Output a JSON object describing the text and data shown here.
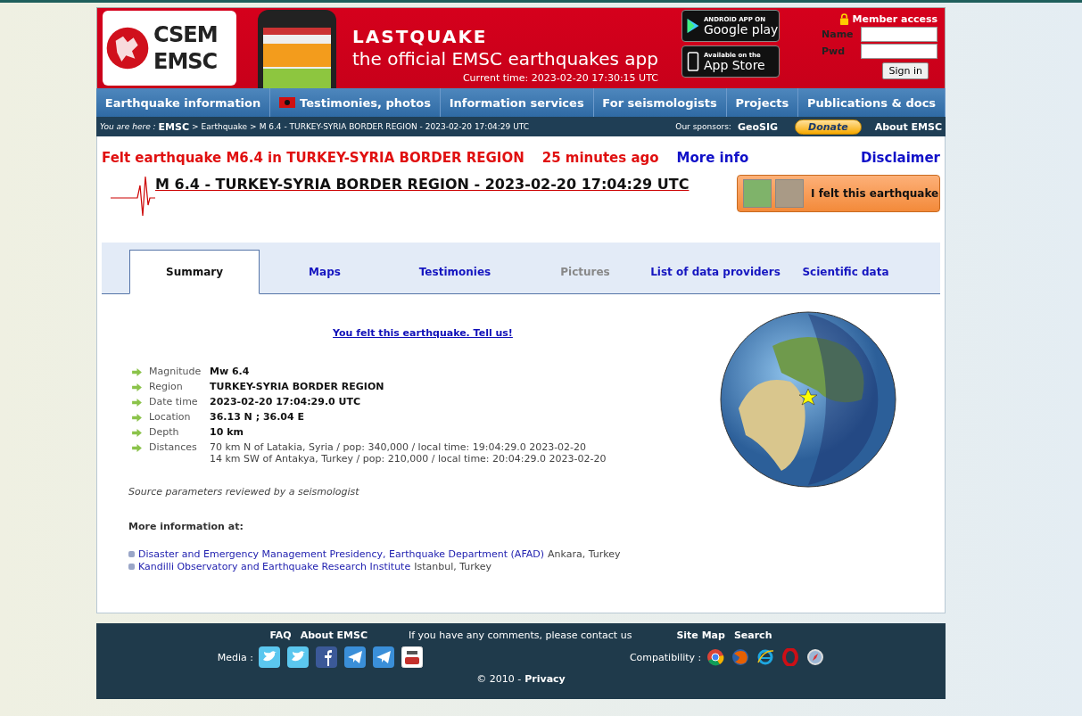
{
  "banner": {
    "logo_lines": [
      "CSEM",
      "EMSC"
    ],
    "app_title": "LASTQUAKE",
    "app_subtitle": "the official EMSC earthquakes app",
    "current_time": "Current time: 2023-02-20 17:30:15 UTC",
    "store_badges": [
      {
        "kind": "android",
        "small": "ANDROID APP ON",
        "big": "Google play"
      },
      {
        "kind": "apple",
        "small": "Available on the",
        "big": "App Store"
      }
    ],
    "member": {
      "title": "Member access",
      "fields": [
        {
          "label": "Name"
        },
        {
          "label": "Pwd"
        }
      ],
      "button": "Sign in"
    }
  },
  "nav": [
    {
      "label": "Earthquake information",
      "kind": "plain"
    },
    {
      "label": "Testimonies, photos",
      "kind": "flag"
    },
    {
      "label": "Information services",
      "kind": "plain"
    },
    {
      "label": "For seismologists",
      "kind": "plain"
    },
    {
      "label": "Projects",
      "kind": "plain"
    },
    {
      "label": "Publications & docs",
      "kind": "plain"
    }
  ],
  "breadcrumb": {
    "prefix": "You are here :",
    "separator": ">",
    "items": [
      "EMSC",
      "Earthquake",
      "M 6.4 - TURKEY-SYRIA BORDER REGION - 2023-02-20 17:04:29 UTC"
    ],
    "sponsors_label": "Our sponsors:",
    "sponsor": "GeoSIG",
    "donate": "Donate",
    "about": "About EMSC"
  },
  "alert": {
    "text": "Felt earthquake M6.4 in TURKEY-SYRIA BORDER REGION",
    "age": "25 minutes ago",
    "more_info": "More info",
    "disclaimer": "Disclaimer"
  },
  "event_title": "M 6.4 - TURKEY-SYRIA BORDER REGION - 2023-02-20 17:04:29 UTC",
  "felt_button": "I felt this earthquake",
  "tabs": [
    {
      "label": "Summary",
      "selected": true,
      "disabled": false
    },
    {
      "label": "Maps",
      "selected": false,
      "disabled": false
    },
    {
      "label": "Testimonies",
      "selected": false,
      "disabled": false
    },
    {
      "label": "Pictures",
      "selected": false,
      "disabled": true
    },
    {
      "label": "List of data providers",
      "selected": false,
      "disabled": false
    },
    {
      "label": "Scientific data",
      "selected": false,
      "disabled": false
    }
  ],
  "felt_link": "You felt this earthquake. Tell us!",
  "params": [
    {
      "label": "Magnitude",
      "values": [
        "Mw 6.4"
      ],
      "bold": true
    },
    {
      "label": "Region",
      "values": [
        "TURKEY-SYRIA BORDER REGION"
      ],
      "bold": true
    },
    {
      "label": "Date time",
      "values": [
        "2023-02-20 17:04:29.0 UTC"
      ],
      "bold": true
    },
    {
      "label": "Location",
      "values": [
        "36.13 N ; 36.04 E"
      ],
      "bold": true
    },
    {
      "label": "Depth",
      "values": [
        "10 km"
      ],
      "bold": true
    },
    {
      "label": "Distances",
      "values": [
        "70 km N of Latakia, Syria / pop: 340,000 / local time: 19:04:29.0 2023-02-20",
        "14 km SW of Antakya, Turkey / pop: 210,000 / local time: 20:04:29.0 2023-02-20"
      ],
      "bold": false
    }
  ],
  "source_note": "Source parameters reviewed by a seismologist",
  "more_info_title": "More information at:",
  "links": [
    {
      "link": "Disaster and Emergency Management Presidency, Earthquake Department (AFAD)",
      "place": "Ankara, Turkey"
    },
    {
      "link": "Kandilli Observatory and Earthquake Research Institute",
      "place": "Istanbul, Turkey"
    }
  ],
  "footer": {
    "links_left": [
      "FAQ",
      "About EMSC"
    ],
    "contact": "If you have any comments, please contact us",
    "links_right": [
      "Site Map",
      "Search"
    ],
    "media_label": "Media :",
    "media": [
      {
        "kind": "twitter"
      },
      {
        "kind": "twitter"
      },
      {
        "kind": "facebook"
      },
      {
        "kind": "telegram"
      },
      {
        "kind": "telegram"
      },
      {
        "kind": "youtube"
      }
    ],
    "compat_label": "Compatibility :",
    "browsers": [
      {
        "kind": "chrome"
      },
      {
        "kind": "firefox"
      },
      {
        "kind": "ie"
      },
      {
        "kind": "opera"
      },
      {
        "kind": "safari"
      }
    ],
    "copyright": "© 2010 -",
    "privacy": "Privacy"
  }
}
